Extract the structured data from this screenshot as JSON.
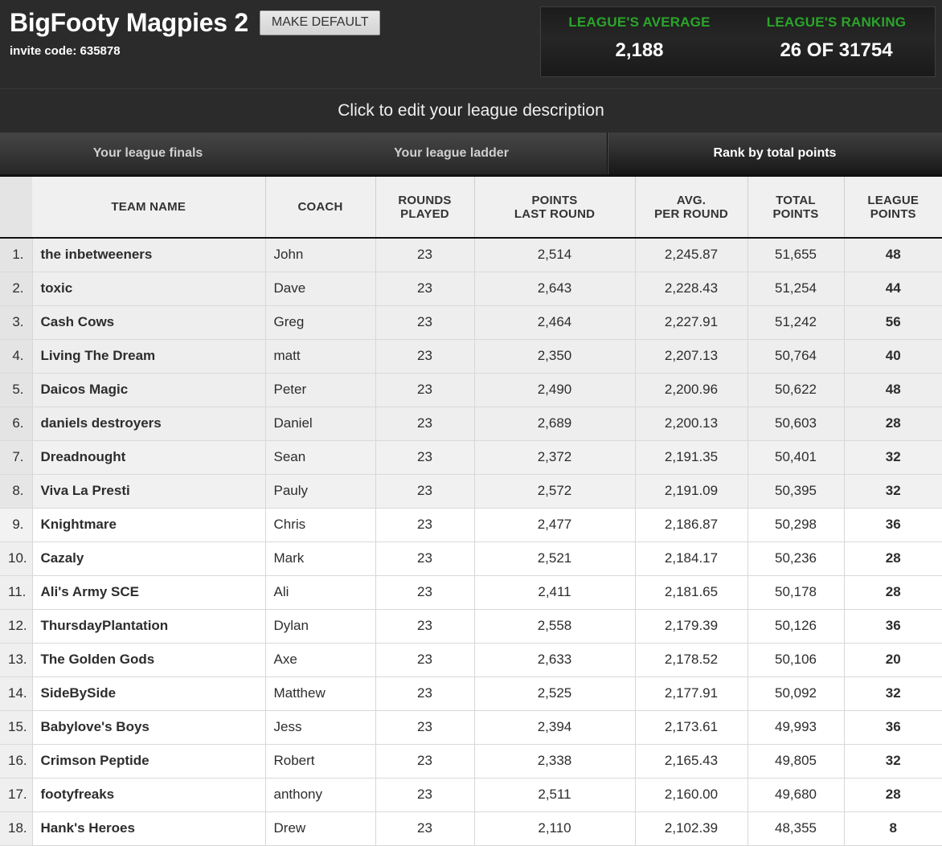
{
  "header": {
    "league_title": "BigFooty Magpies 2",
    "make_default_label": "MAKE DEFAULT",
    "invite_code": "invite code: 635878"
  },
  "stats": {
    "average_label": "LEAGUE'S AVERAGE",
    "average_value": "2,188",
    "ranking_label": "LEAGUE'S RANKING",
    "ranking_value": "26 OF 31754"
  },
  "description": {
    "text": "Click to edit your league description"
  },
  "tabs": [
    {
      "label": "Your league finals",
      "active": false
    },
    {
      "label": "Your league ladder",
      "active": false
    },
    {
      "label": "Rank by total points",
      "active": true
    }
  ],
  "table": {
    "columns": [
      "",
      "TEAM NAME",
      "COACH",
      "ROUNDS PLAYED",
      "POINTS LAST ROUND",
      "AVG. PER ROUND",
      "TOTAL POINTS",
      "LEAGUE POINTS"
    ],
    "columns_line1": [
      "",
      "TEAM NAME",
      "COACH",
      "ROUNDS",
      "POINTS",
      "AVG.",
      "TOTAL",
      "LEAGUE"
    ],
    "columns_line2": [
      "",
      "",
      "",
      "PLAYED",
      "LAST ROUND",
      "PER ROUND",
      "POINTS",
      "POINTS"
    ],
    "rows": [
      {
        "rank": "1.",
        "team": "the inbetweeners",
        "coach": "John",
        "rounds": "23",
        "last_round": "2,514",
        "avg_per_round": "2,245.87",
        "total_points": "51,655",
        "league_points": "48"
      },
      {
        "rank": "2.",
        "team": "toxic",
        "coach": "Dave",
        "rounds": "23",
        "last_round": "2,643",
        "avg_per_round": "2,228.43",
        "total_points": "51,254",
        "league_points": "44"
      },
      {
        "rank": "3.",
        "team": "Cash Cows",
        "coach": "Greg",
        "rounds": "23",
        "last_round": "2,464",
        "avg_per_round": "2,227.91",
        "total_points": "51,242",
        "league_points": "56"
      },
      {
        "rank": "4.",
        "team": "Living The Dream",
        "coach": "matt",
        "rounds": "23",
        "last_round": "2,350",
        "avg_per_round": "2,207.13",
        "total_points": "50,764",
        "league_points": "40"
      },
      {
        "rank": "5.",
        "team": "Daicos Magic",
        "coach": "Peter",
        "rounds": "23",
        "last_round": "2,490",
        "avg_per_round": "2,200.96",
        "total_points": "50,622",
        "league_points": "48"
      },
      {
        "rank": "6.",
        "team": "daniels destroyers",
        "coach": "Daniel",
        "rounds": "23",
        "last_round": "2,689",
        "avg_per_round": "2,200.13",
        "total_points": "50,603",
        "league_points": "28"
      },
      {
        "rank": "7.",
        "team": "Dreadnought",
        "coach": "Sean",
        "rounds": "23",
        "last_round": "2,372",
        "avg_per_round": "2,191.35",
        "total_points": "50,401",
        "league_points": "32"
      },
      {
        "rank": "8.",
        "team": "Viva La Presti",
        "coach": "Pauly",
        "rounds": "23",
        "last_round": "2,572",
        "avg_per_round": "2,191.09",
        "total_points": "50,395",
        "league_points": "32"
      },
      {
        "rank": "9.",
        "team": "Knightmare",
        "coach": "Chris",
        "rounds": "23",
        "last_round": "2,477",
        "avg_per_round": "2,186.87",
        "total_points": "50,298",
        "league_points": "36"
      },
      {
        "rank": "10.",
        "team": "Cazaly",
        "coach": "Mark",
        "rounds": "23",
        "last_round": "2,521",
        "avg_per_round": "2,184.17",
        "total_points": "50,236",
        "league_points": "28"
      },
      {
        "rank": "11.",
        "team": "Ali's Army SCE",
        "coach": "Ali",
        "rounds": "23",
        "last_round": "2,411",
        "avg_per_round": "2,181.65",
        "total_points": "50,178",
        "league_points": "28"
      },
      {
        "rank": "12.",
        "team": "ThursdayPlantation",
        "coach": "Dylan",
        "rounds": "23",
        "last_round": "2,558",
        "avg_per_round": "2,179.39",
        "total_points": "50,126",
        "league_points": "36"
      },
      {
        "rank": "13.",
        "team": "The Golden Gods",
        "coach": "Axe",
        "rounds": "23",
        "last_round": "2,633",
        "avg_per_round": "2,178.52",
        "total_points": "50,106",
        "league_points": "20"
      },
      {
        "rank": "14.",
        "team": "SideBySide",
        "coach": "Matthew",
        "rounds": "23",
        "last_round": "2,525",
        "avg_per_round": "2,177.91",
        "total_points": "50,092",
        "league_points": "32"
      },
      {
        "rank": "15.",
        "team": "Babylove's Boys",
        "coach": "Jess",
        "rounds": "23",
        "last_round": "2,394",
        "avg_per_round": "2,173.61",
        "total_points": "49,993",
        "league_points": "36"
      },
      {
        "rank": "16.",
        "team": "Crimson Peptide",
        "coach": "Robert",
        "rounds": "23",
        "last_round": "2,338",
        "avg_per_round": "2,165.43",
        "total_points": "49,805",
        "league_points": "32"
      },
      {
        "rank": "17.",
        "team": "footyfreaks",
        "coach": "anthony",
        "rounds": "23",
        "last_round": "2,511",
        "avg_per_round": "2,160.00",
        "total_points": "49,680",
        "league_points": "28"
      },
      {
        "rank": "18.",
        "team": "Hank's Heroes",
        "coach": "Drew",
        "rounds": "23",
        "last_round": "2,110",
        "avg_per_round": "2,102.39",
        "total_points": "48,355",
        "league_points": "8"
      }
    ]
  },
  "colors": {
    "header_bg": "#2b2b2b",
    "accent_green": "#2aa52a",
    "stat_value": "#ffffff",
    "table_header_bg": "#f0f0f0"
  }
}
